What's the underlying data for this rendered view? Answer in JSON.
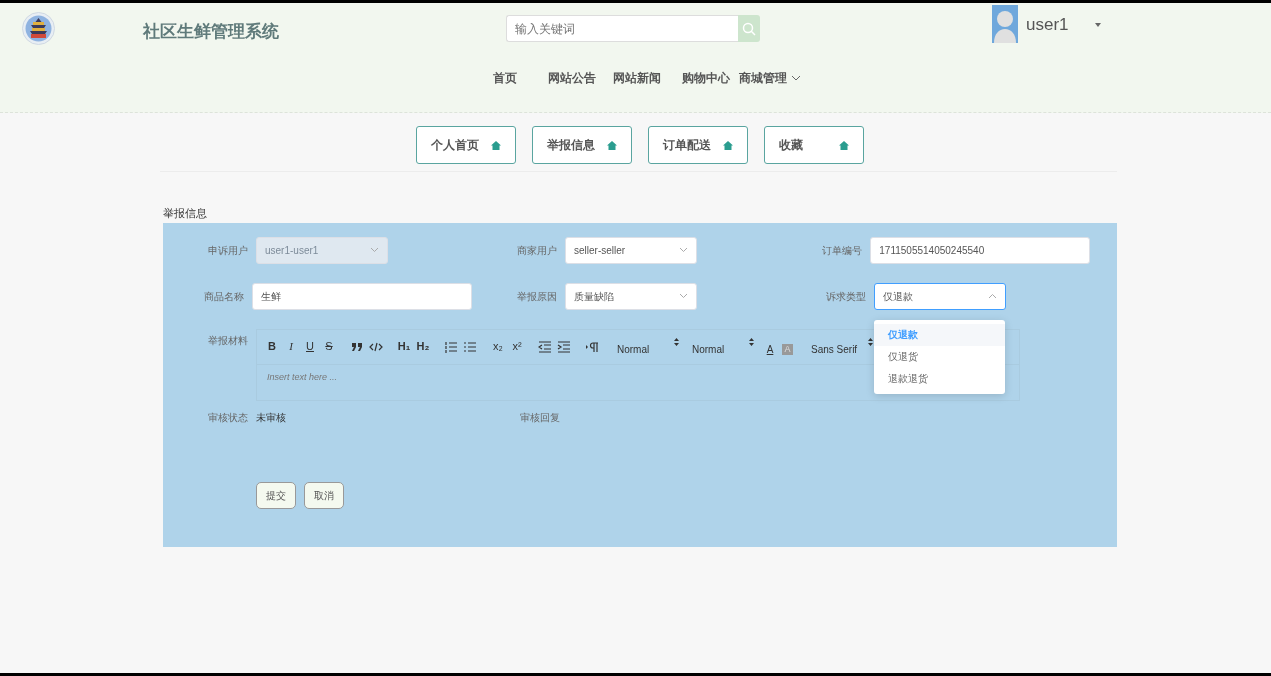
{
  "header": {
    "title": "社区生鲜管理系统",
    "search": {
      "placeholder": "输入关键词"
    },
    "user": {
      "name": "user1"
    }
  },
  "nav": [
    {
      "label": "首页",
      "dropdown": false
    },
    {
      "label": "网站公告",
      "dropdown": false
    },
    {
      "label": "网站新闻",
      "dropdown": false
    },
    {
      "label": "购物中心",
      "dropdown": false
    },
    {
      "label": "商城管理",
      "dropdown": true
    }
  ],
  "tabs": [
    {
      "label": "个人首页",
      "selected": false
    },
    {
      "label": "举报信息",
      "selected": false
    },
    {
      "label": "订单配送",
      "selected": false
    },
    {
      "label": "收藏",
      "selected": false
    }
  ],
  "form": {
    "title": "举报信息",
    "rows": [
      [
        {
          "label": "申诉用户",
          "kind": "select",
          "value": "user1-user1",
          "disabled": true
        },
        {
          "label": "商家用户",
          "kind": "select",
          "value": "seller-seller",
          "disabled": false
        },
        {
          "label": "订单编号",
          "kind": "input",
          "value": "1711505514050245540",
          "disabled": false
        }
      ],
      [
        {
          "label": "商品名称",
          "kind": "input",
          "value": "生鲜",
          "disabled": false
        },
        {
          "label": "举报原因",
          "kind": "select",
          "value": "质量缺陷",
          "disabled": false
        },
        {
          "label": "诉求类型",
          "kind": "select",
          "value": "仅退款",
          "disabled": false,
          "expanded": true,
          "options": [
            {
              "label": "仅退款",
              "selected": true
            },
            {
              "label": "仅退货",
              "selected": false
            },
            {
              "label": "退款退货",
              "selected": false
            }
          ]
        }
      ]
    ],
    "editor": {
      "label": "举报材料",
      "placeholder": "Insert text here ...",
      "toolbar": [
        {
          "kind": "bold",
          "text": "B"
        },
        {
          "kind": "italic",
          "text": "I"
        },
        {
          "kind": "underline",
          "text": "U"
        },
        {
          "kind": "strike",
          "text": "S"
        },
        {
          "kind": "gap"
        },
        {
          "kind": "quote"
        },
        {
          "kind": "code"
        },
        {
          "kind": "gap"
        },
        {
          "kind": "header",
          "text": "H₁"
        },
        {
          "kind": "header",
          "text": "H₂"
        },
        {
          "kind": "gap"
        },
        {
          "kind": "ordered-list"
        },
        {
          "kind": "bullet-list"
        },
        {
          "kind": "gap"
        },
        {
          "kind": "script",
          "text": "x₂"
        },
        {
          "kind": "script",
          "text": "x²"
        },
        {
          "kind": "gap"
        },
        {
          "kind": "outdent"
        },
        {
          "kind": "indent"
        },
        {
          "kind": "gap"
        },
        {
          "kind": "direction"
        },
        {
          "kind": "gap"
        },
        {
          "kind": "picker",
          "text": "Normal"
        },
        {
          "kind": "picker",
          "text": "Normal"
        },
        {
          "kind": "color",
          "text": "A"
        },
        {
          "kind": "background",
          "text": "A"
        },
        {
          "kind": "gap"
        },
        {
          "kind": "picker",
          "text": "Sans Serif"
        }
      ]
    },
    "status": {
      "label": "审核状态",
      "value": "未审核"
    },
    "reply": {
      "label": "审核回复"
    },
    "buttons": [
      "提交",
      "取消"
    ]
  }
}
